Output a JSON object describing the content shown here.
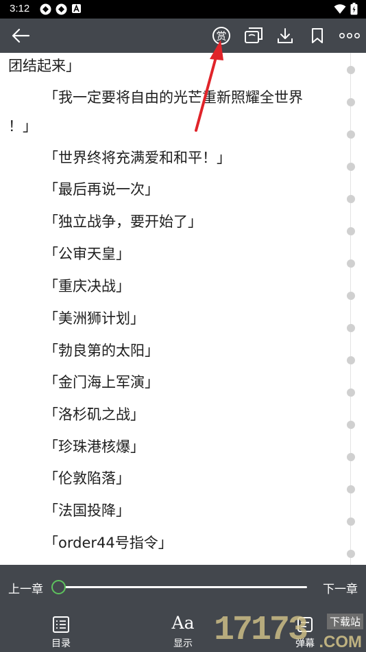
{
  "status": {
    "time": "3:12",
    "icons_left": [
      "app-icon",
      "app-icon",
      "notification-a-icon"
    ],
    "icons_right": [
      "wifi-icon",
      "battery-icon"
    ]
  },
  "toolbar": {
    "icons": [
      "back-arrow-icon",
      "reward-icon",
      "cast-icon",
      "download-icon",
      "bookmark-icon",
      "more-icon"
    ],
    "reward_glyph": "赏"
  },
  "content": {
    "lines": [
      "团结起来」",
      "「我一定要将自由的光芒重新照耀全世界",
      "！」",
      "「世界终将充满爱和和平！」",
      "「最后再说一次」",
      "「独立战争，要开始了」",
      "「公审天皇」",
      "「重庆决战」",
      "「美洲狮计划」",
      "「勃良第的太阳」",
      "「金门海上军演」",
      "「洛杉矶之战」",
      "「珍珠港核爆」",
      "「伦敦陷落」",
      "「法国投降」",
      "「order44号指令」"
    ]
  },
  "chapter_nav": {
    "prev_label": "上一章",
    "next_label": "下一章",
    "progress": 0
  },
  "bottom_nav": {
    "items": [
      {
        "label": "目录",
        "icon": "toc-icon"
      },
      {
        "label": "显示",
        "icon": "font-size-icon",
        "glyph": "Aa"
      },
      {
        "label": "弹幕",
        "icon": "danmaku-icon"
      }
    ]
  },
  "watermark": {
    "number": "17173",
    "tag": "下载站",
    "domain": ".COM"
  },
  "colors": {
    "bar_background": "#43474d",
    "accent_green": "#5ec35e",
    "annotation_red": "#e0242a",
    "text": "#1e1e1e"
  }
}
